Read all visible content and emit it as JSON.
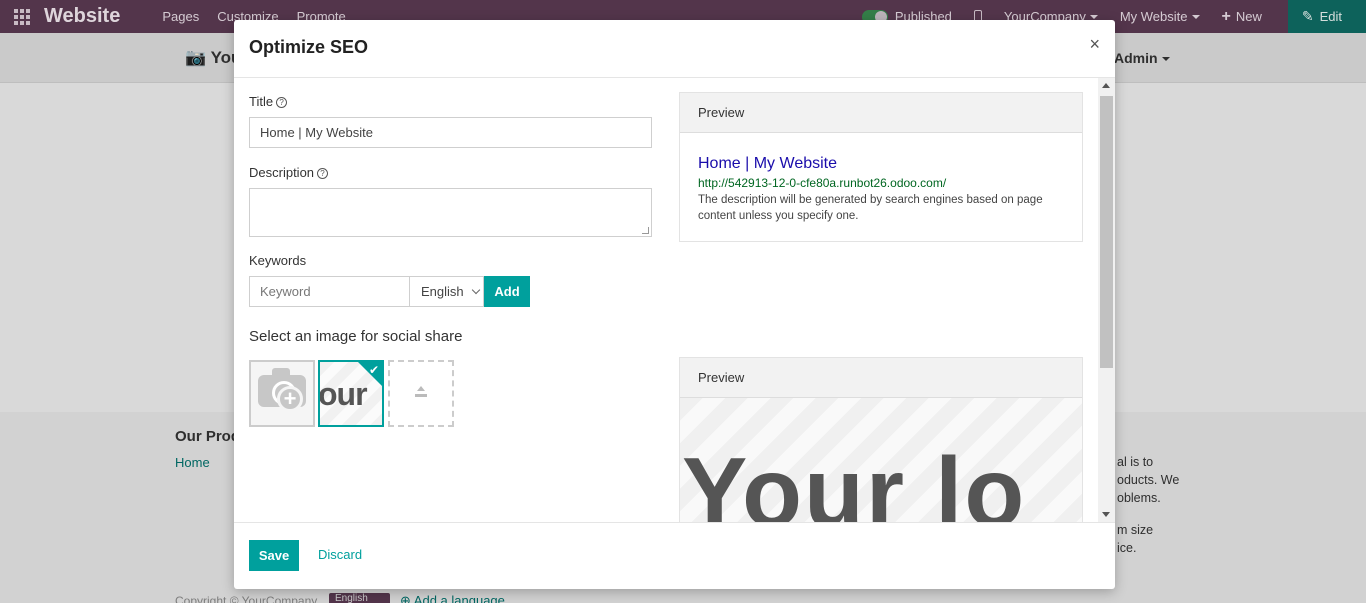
{
  "navbar": {
    "brand": "Website",
    "menu": [
      "Pages",
      "Customize",
      "Promote"
    ],
    "published": "Published",
    "company": "YourCompany",
    "website": "My Website",
    "new": "New",
    "edit": "Edit"
  },
  "background": {
    "logo_text": "You",
    "admin": "Admin",
    "products_heading": "Our Prod",
    "home_link": "Home",
    "right_text_1": "al is to",
    "right_text_2": "oducts. We",
    "right_text_3": "oblems.",
    "right_text_4": "m size",
    "right_text_5": "ice.",
    "copyright": "Copyright © YourCompany",
    "lang_badge": "English",
    "add_language": "Add a language"
  },
  "modal": {
    "title": "Optimize SEO",
    "close": "×",
    "title_label": "Title",
    "title_value": "Home | My Website",
    "description_label": "Description",
    "keywords_label": "Keywords",
    "keyword_placeholder": "Keyword",
    "keyword_language": "English",
    "add_label": "Add",
    "social_title": "Select an image for social share",
    "thumb_text": "our",
    "preview_label": "Preview",
    "preview_title": "Home | My Website",
    "preview_url": "http://542913-12-0-cfe80a.runbot26.odoo.com/",
    "preview_description": "The description will be generated by search engines based on page content unless you specify one.",
    "social_preview_label": "Preview",
    "social_preview_text": "Your lo",
    "save_label": "Save",
    "discard_label": "Discard"
  },
  "colors": {
    "navbar": "#5b3a52",
    "accent": "#00a09d",
    "link_blue": "#1a0dab",
    "url_green": "#006621"
  }
}
